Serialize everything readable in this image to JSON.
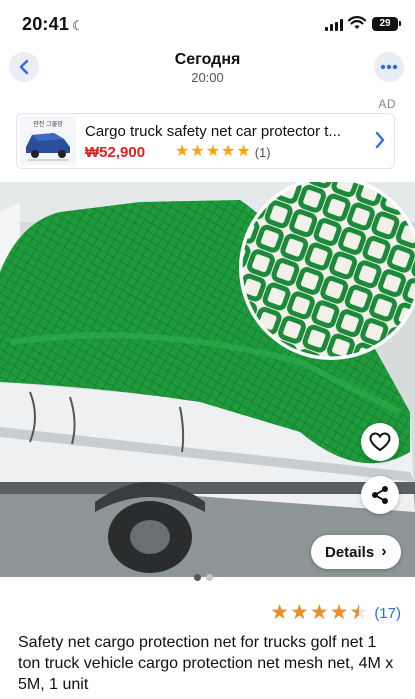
{
  "status_bar": {
    "time": "20:41",
    "battery": "29"
  },
  "nav": {
    "title": "Сегодня",
    "subtitle": "20:00"
  },
  "ad": {
    "label": "AD",
    "thumb_caption": "안전 그물망",
    "title": "Cargo truck safety net car protector t...",
    "price": "₩52,900",
    "rating_stars": 5,
    "review_count": "(1)"
  },
  "product": {
    "details_label": "Details",
    "rating": 4.5,
    "review_count": "(17)",
    "description": "Safety net cargo protection net for trucks golf net 1 ton truck vehicle cargo protection net mesh net, 4M x 5M, 1 unit",
    "carousel": {
      "pages": 2,
      "active": 1
    }
  },
  "colors": {
    "net_green": "#1f9a3c",
    "price_red": "#e02020",
    "star_orange": "#f08c2a",
    "link_blue": "#2d6fd6",
    "accent_blue": "#2f6fe0"
  },
  "icons": [
    "moon-icon",
    "signal-icon",
    "wifi-icon",
    "battery-icon",
    "back-chevron-icon",
    "more-dots-icon",
    "chevron-right-icon",
    "heart-icon",
    "share-icon"
  ]
}
